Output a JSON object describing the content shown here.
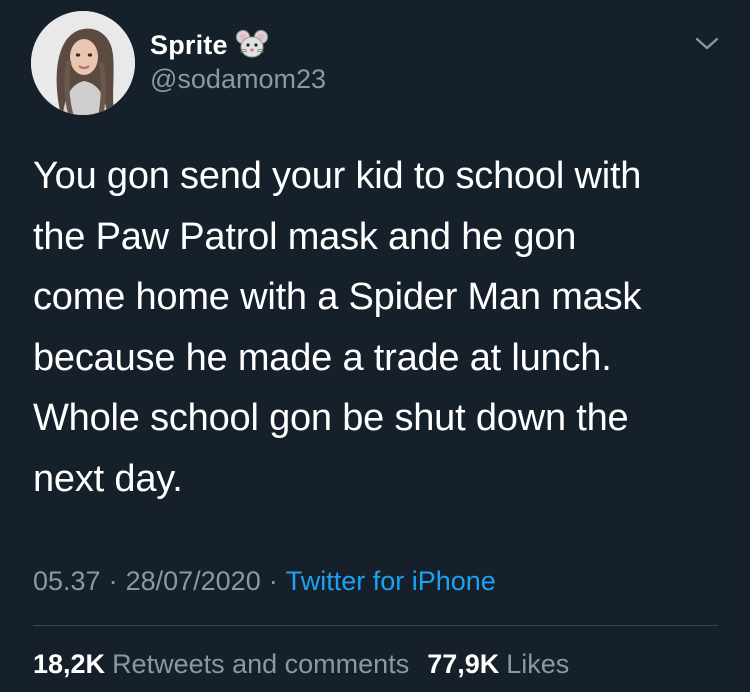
{
  "user": {
    "display_name": "Sprite",
    "handle": "@sodamom23",
    "name_emoji_icon": "mouse-face-icon",
    "avatar_icon": "profile-photo"
  },
  "tweet": {
    "text": "You gon send your kid to school with\nthe Paw Patrol mask and he gon\ncome home with a Spider Man mask\nbecause he made a trade at lunch.\nWhole school gon be shut down the\nnext day."
  },
  "meta": {
    "time": "05.37",
    "separator": "·",
    "date": "28/07/2020",
    "source": "Twitter for iPhone"
  },
  "stats": {
    "retweets_count": "18,2K",
    "retweets_label": "Retweets and comments",
    "likes_count": "77,9K",
    "likes_label": "Likes"
  },
  "colors": {
    "background": "#15202b",
    "text_primary": "#ffffff",
    "text_secondary": "#8899a6",
    "link": "#1da1f2",
    "divider": "#38444d"
  },
  "icons": {
    "menu": "chevron-down-icon"
  }
}
